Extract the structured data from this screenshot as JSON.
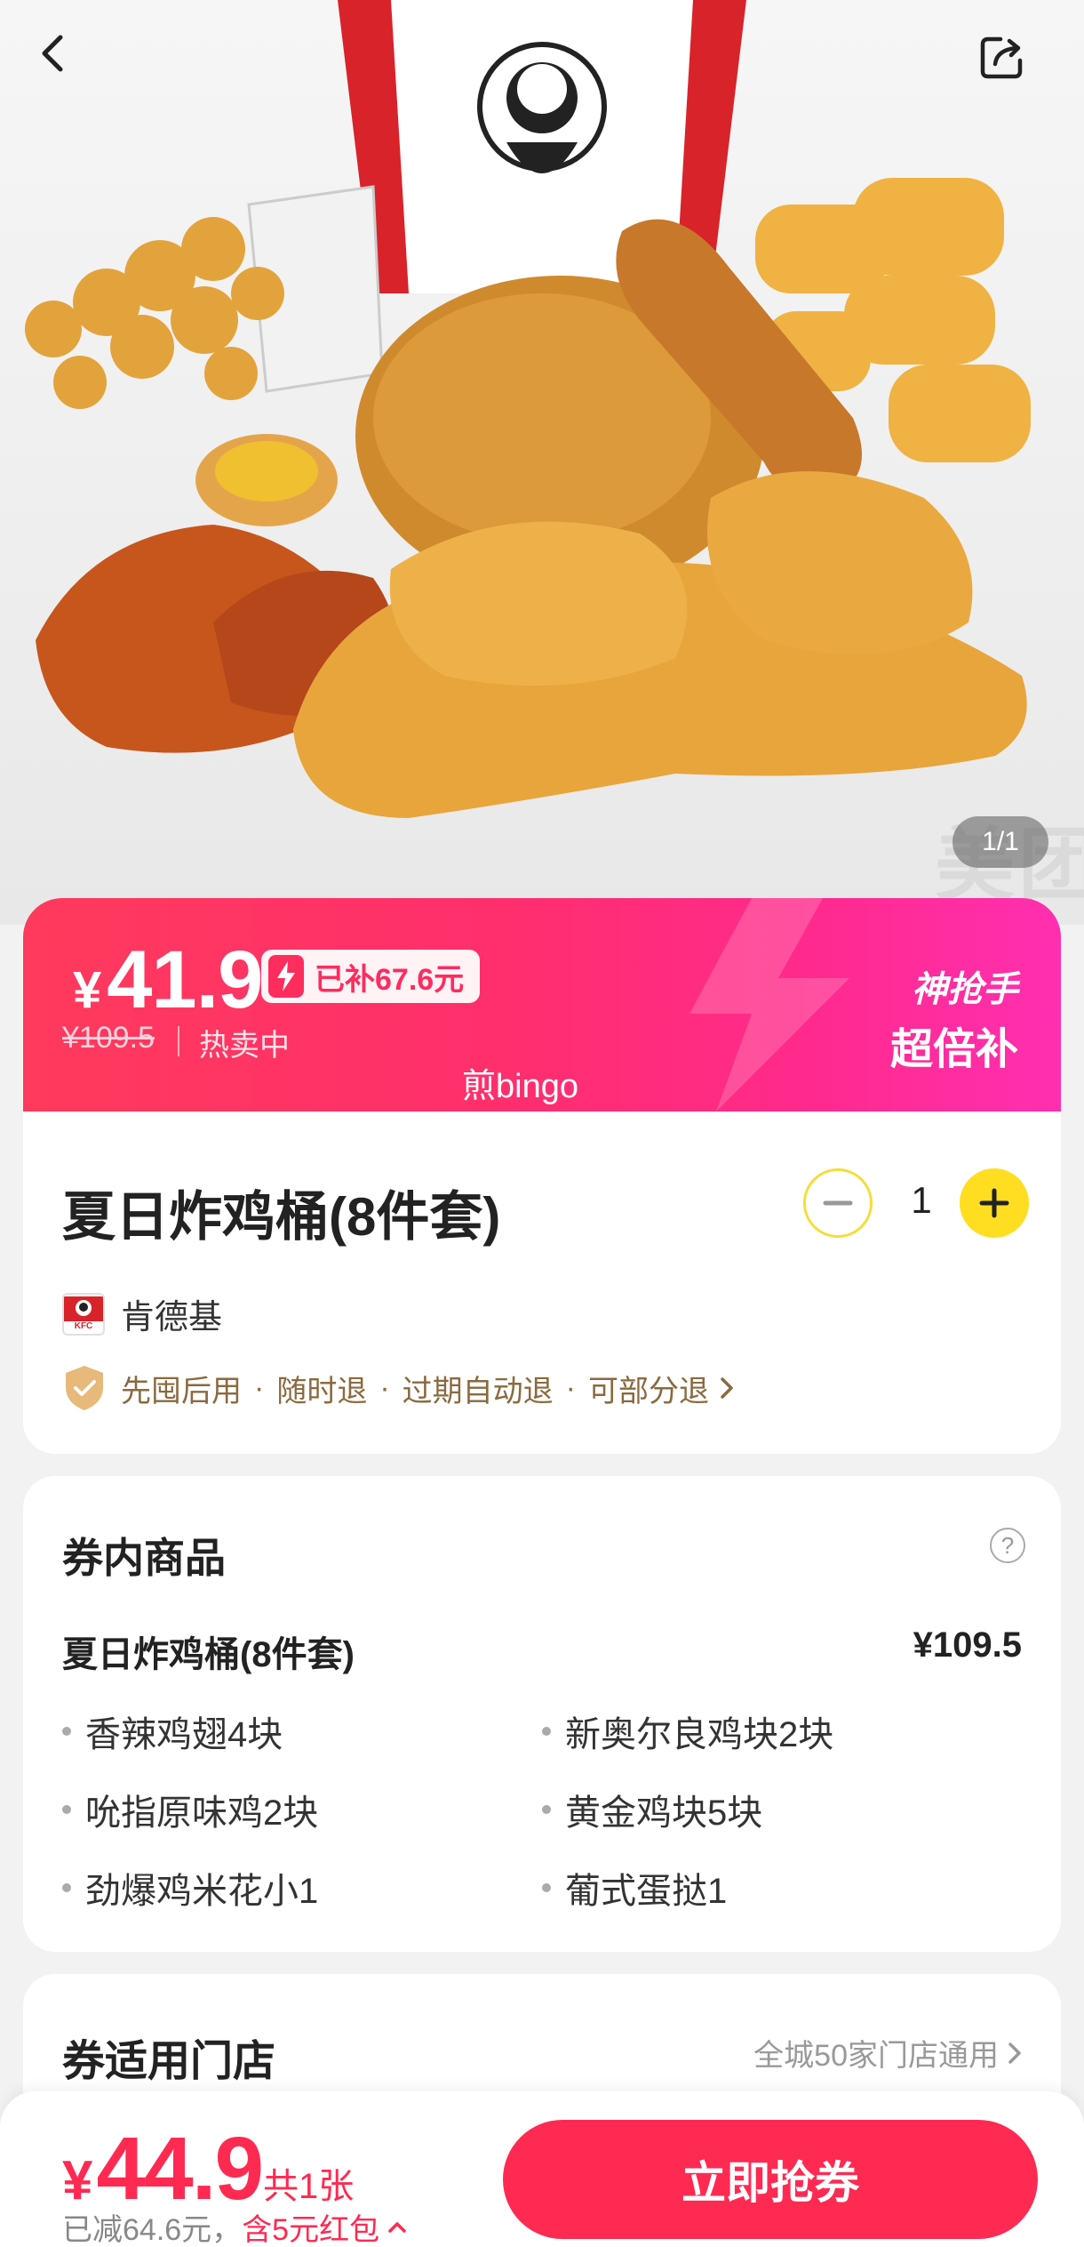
{
  "hero": {
    "image_counter": "1/1",
    "watermark": "美团",
    "icons": {
      "back": "chevron-left-icon",
      "share": "share-icon"
    }
  },
  "price_banner": {
    "currency": "¥",
    "price": "41.9",
    "subsidy_tag": "已补67.6元",
    "original_price": "¥109.5",
    "hot_label": "热卖中",
    "bingo": "煎bingo",
    "badge_line1": "神抢手",
    "badge_line2": "超倍补",
    "colors": {
      "gradient_start": "#ff3a5c",
      "gradient_end": "#ff2fb0"
    }
  },
  "product": {
    "title": "夏日炸鸡桶(8件套)",
    "quantity": "1",
    "brand_name": "肯德基",
    "brand_logo_text": "KFC",
    "guarantees": [
      "先囤后用",
      "随时退",
      "过期自动退",
      "可部分退"
    ],
    "separator": "·"
  },
  "voucher_contents": {
    "title": "券内商品",
    "help_symbol": "?",
    "package_name": "夏日炸鸡桶(8件套)",
    "package_price": "¥109.5",
    "items": [
      "香辣鸡翅4块",
      "新奥尔良鸡块2块",
      "吮指原味鸡2块",
      "黄金鸡块5块",
      "劲爆鸡米花小1",
      "葡式蛋挞1"
    ]
  },
  "stores": {
    "title": "券适用门店",
    "link": "全城50家门店通用"
  },
  "bottom_bar": {
    "currency": "¥",
    "final_price": "44.9",
    "count_label": "共1张",
    "discount_text": "已减64.6元，",
    "red_packet_text": "含5元红包",
    "buy_button": "立即抢券",
    "accent_color": "#ff2a52"
  }
}
